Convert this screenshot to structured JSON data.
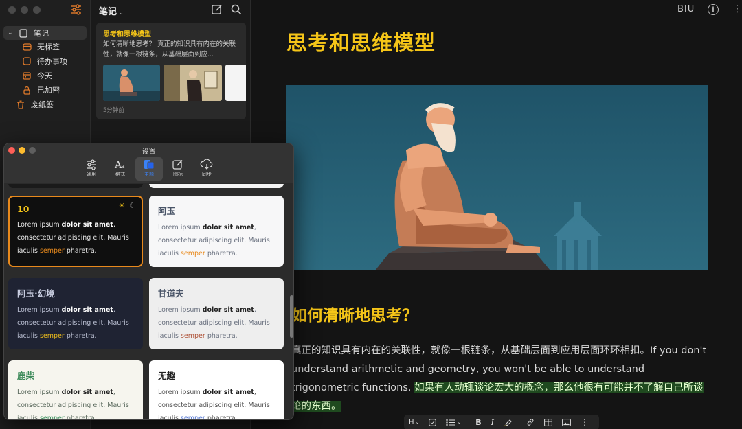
{
  "sidebar": {
    "root_label": "笔记",
    "items": [
      {
        "label": "无标签",
        "icon": "tag-icon"
      },
      {
        "label": "待办事项",
        "icon": "checkbox-icon"
      },
      {
        "label": "今天",
        "icon": "calendar-icon"
      },
      {
        "label": "已加密",
        "icon": "lock-icon"
      }
    ],
    "trash_label": "废纸篓"
  },
  "notelist": {
    "title": "笔记",
    "card": {
      "title": "思考和思维模型",
      "snippet": "如何清晰地思考？ 真正的知识具有内在的关联性，就像一根链条，从基础层面到应...",
      "time": "5分钟前"
    }
  },
  "editor": {
    "biu": "BIU",
    "title": "思考和思维模型",
    "heading": "如何清晰地思考？",
    "para_plain": "真正的知识具有内在的关联性，就像一根链条，从基础层面到应用层面环环相扣。If you don't understand arithmetic and geometry, you won't be able to understand trigonometric functions. ",
    "para_highlight": "如果有人动辄谈论宏大的概念，那么他很有可能并不了解自己所谈论的东西。",
    "toolbar": {
      "heading": "H",
      "bold": "B",
      "italic": "I"
    }
  },
  "settings": {
    "title": "设置",
    "tabs": [
      {
        "label": "通用",
        "icon": "sliders-icon"
      },
      {
        "label": "格式",
        "icon": "font-icon"
      },
      {
        "label": "主题",
        "icon": "theme-icon"
      },
      {
        "label": "图标",
        "icon": "edit-icon"
      },
      {
        "label": "同步",
        "icon": "cloud-sync-icon"
      }
    ],
    "active_tab": 2,
    "sample": {
      "pre": "Lorem ipsum ",
      "bold": "dolor sit amet",
      "mid": ", consectetur adipiscing elit. Mauris iaculis ",
      "accent": "semper",
      "post": " pharetra."
    },
    "themes": [
      {
        "name": "10",
        "bg": "#0f0f0f",
        "title_color": "#f5c518",
        "text": "#e8e8e8",
        "accent": "#e8891c",
        "selected": true
      },
      {
        "name": "阿玉",
        "bg": "#f7f7f8",
        "title_color": "#4a5568",
        "text": "#6b7280",
        "accent": "#e8891c",
        "selected": false
      },
      {
        "name": "阿玉·幻境",
        "bg": "#1f2333",
        "title_color": "#c8cde0",
        "text": "#b8bdd0",
        "accent": "#e8b91c",
        "selected": false
      },
      {
        "name": "甘道夫",
        "bg": "#eeeeee",
        "title_color": "#4a5568",
        "text": "#6b7280",
        "accent": "#b0563c",
        "selected": false
      },
      {
        "name": "鹿柴",
        "bg": "#f6f5ee",
        "title_color": "#3d8a5a",
        "text": "#5b6a5e",
        "accent": "#2f8a55",
        "selected": false
      },
      {
        "name": "无趣",
        "bg": "#ffffff",
        "title_color": "#222222",
        "text": "#555555",
        "accent": "#4a6fd0",
        "selected": false
      }
    ]
  },
  "colors": {
    "accent_yellow": "#f5c518",
    "select_orange": "#e8891c",
    "highlight_green": "#1f4a1f"
  }
}
